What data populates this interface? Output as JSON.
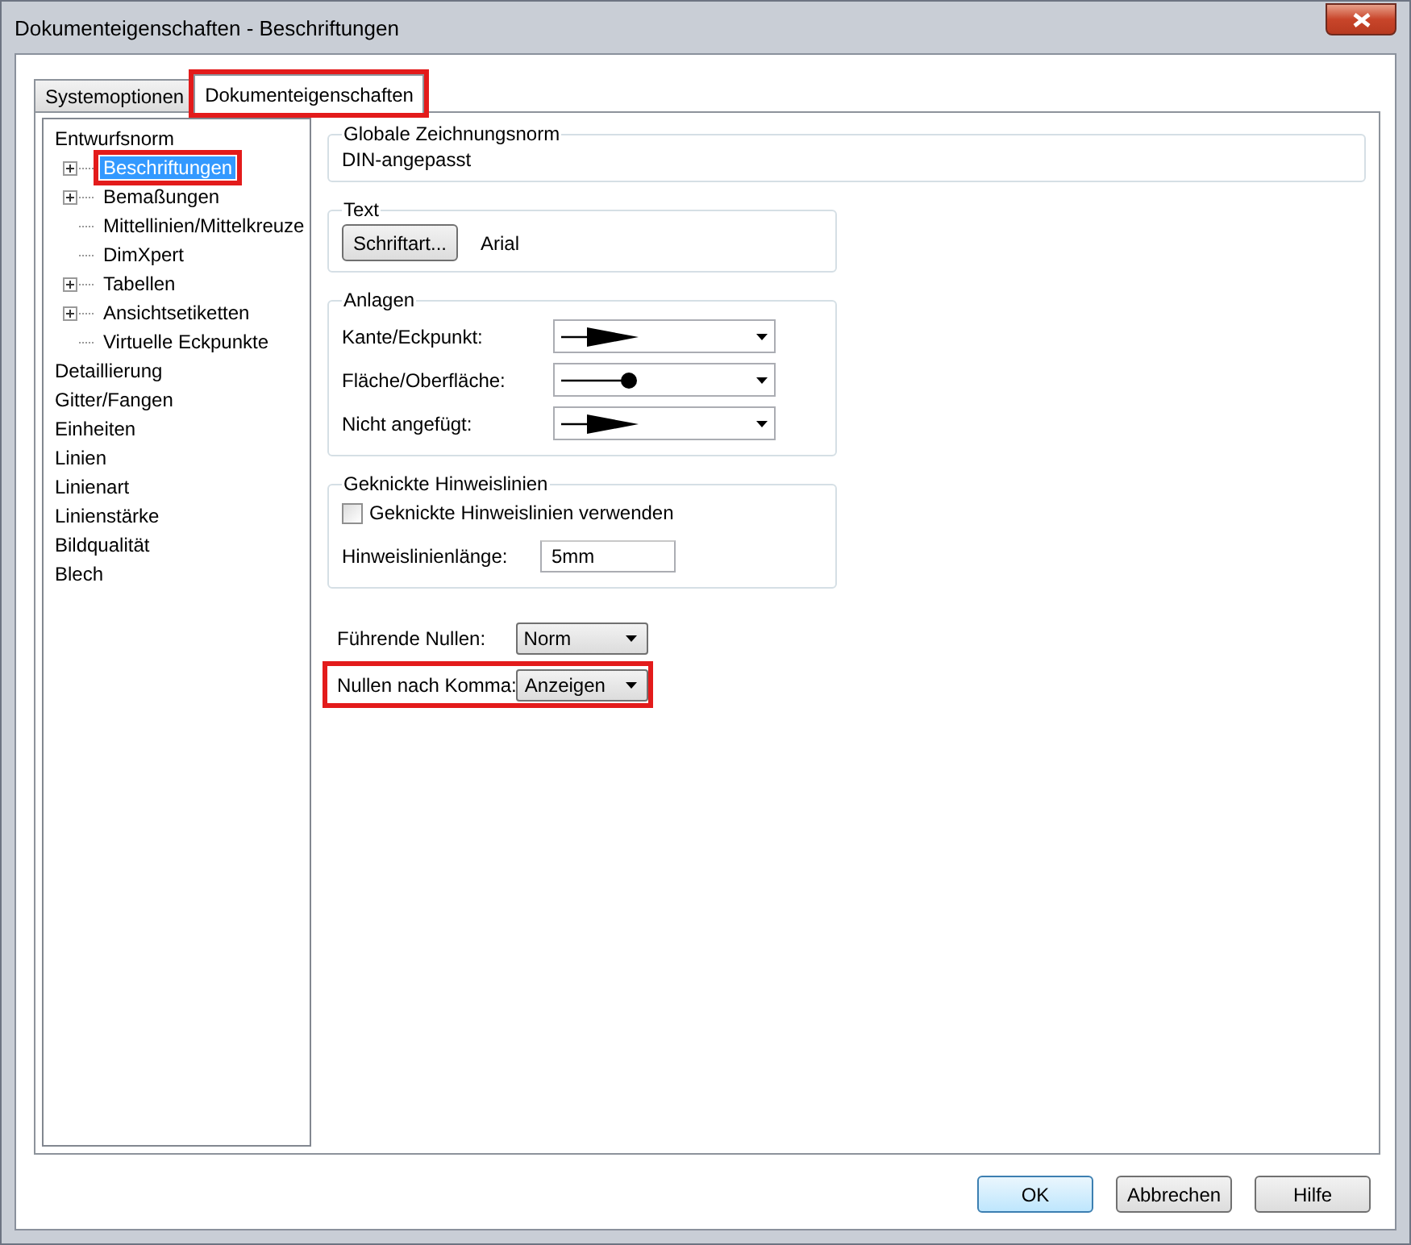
{
  "window": {
    "title": "Dokumenteigenschaften - Beschriftungen"
  },
  "tabs": [
    {
      "label": "Systemoptionen",
      "selected": false,
      "highlighted": false
    },
    {
      "label": "Dokumenteigenschaften",
      "selected": true,
      "highlighted": true
    }
  ],
  "tree": [
    {
      "label": "Entwurfsnorm",
      "selected": false,
      "highlighted": false,
      "children": [
        {
          "label": "Beschriftungen",
          "expandable": true,
          "selected": true,
          "highlighted": true
        },
        {
          "label": "Bemaßungen",
          "expandable": true,
          "selected": false,
          "highlighted": false
        },
        {
          "label": "Mittellinien/Mittelkreuze",
          "expandable": false,
          "selected": false,
          "highlighted": false
        },
        {
          "label": "DimXpert",
          "expandable": false,
          "selected": false,
          "highlighted": false
        },
        {
          "label": "Tabellen",
          "expandable": true,
          "selected": false,
          "highlighted": false
        },
        {
          "label": "Ansichtsetiketten",
          "expandable": true,
          "selected": false,
          "highlighted": false
        },
        {
          "label": "Virtuelle Eckpunkte",
          "expandable": false,
          "selected": false,
          "highlighted": false
        }
      ]
    },
    {
      "label": "Detaillierung",
      "selected": false,
      "highlighted": false
    },
    {
      "label": "Gitter/Fangen",
      "selected": false,
      "highlighted": false
    },
    {
      "label": "Einheiten",
      "selected": false,
      "highlighted": false
    },
    {
      "label": "Linien",
      "selected": false,
      "highlighted": false
    },
    {
      "label": "Linienart",
      "selected": false,
      "highlighted": false
    },
    {
      "label": "Linienstärke",
      "selected": false,
      "highlighted": false
    },
    {
      "label": "Bildqualität",
      "selected": false,
      "highlighted": false
    },
    {
      "label": "Blech",
      "selected": false,
      "highlighted": false
    }
  ],
  "global_standard": {
    "legend": "Globale Zeichnungsnorm",
    "value": "DIN-angepasst"
  },
  "text_group": {
    "legend": "Text",
    "button": "Schriftart...",
    "font": "Arial"
  },
  "attachments": {
    "legend": "Anlagen",
    "rows": [
      {
        "label": "Kante/Eckpunkt:",
        "kind": "arrow"
      },
      {
        "label": "Fläche/Oberfläche:",
        "kind": "dot"
      },
      {
        "label": "Nicht angefügt:",
        "kind": "arrow"
      }
    ]
  },
  "leaders": {
    "legend": "Geknickte Hinweislinien",
    "checkbox": {
      "label": "Geknickte Hinweislinien verwenden",
      "checked": false
    },
    "length_label": "Hinweislinienlänge:",
    "length_value": "5mm"
  },
  "zeros": [
    {
      "label": "Führende Nullen:",
      "value": "Norm",
      "highlighted": false
    },
    {
      "label": "Nullen nach Komma:",
      "value": "Anzeigen",
      "highlighted": true
    }
  ],
  "buttons": [
    {
      "label": "OK",
      "default": true
    },
    {
      "label": "Abbrechen",
      "default": false
    },
    {
      "label": "Hilfe",
      "default": false
    }
  ]
}
